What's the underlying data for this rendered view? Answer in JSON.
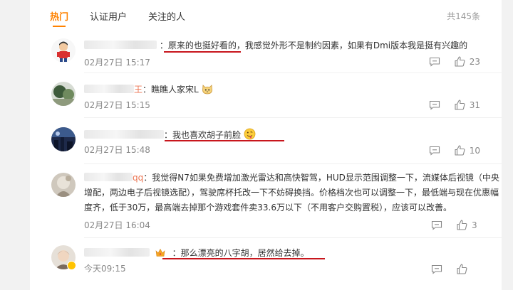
{
  "tabs": [
    {
      "label": "热门",
      "active": true
    },
    {
      "label": "认证用户",
      "active": false
    },
    {
      "label": "关注的人",
      "active": false
    }
  ],
  "total": "共145条",
  "accent_color": "#ff8200",
  "underline_color": "#c8161d",
  "comments": [
    {
      "text_highlight": "原来的也挺好看的",
      "text_rest": "，我感觉外形不是制约因素，如果有Dmi版本我是挺有兴趣的",
      "time": "02月27日 15:17",
      "likes": "23"
    },
    {
      "name_tail": "王",
      "text": "瞧瞧人家宋L",
      "emoji": "cat-face",
      "time": "02月27日 15:15",
      "likes": "31"
    },
    {
      "text_highlight": "我也喜欢胡子前脸",
      "emoji": "tongue-out-face",
      "time": "02月27日 15:48",
      "likes": "10"
    },
    {
      "name_tail": "qq",
      "text": "我觉得N7如果免费增加激光雷达和高快智驾，HUD显示范围调整一下，流媒体后视镜（中央增配，两边电子后视镜选配），驾驶席杯托改一下不妨碍换挡。价格档次也可以调整一下，最低端与现在优惠幅度齐，低于30万，最高端去掉那个游戏套件卖33.6万以下（不用客户交购置税），应该可以改善。",
      "time": "02月27日 16:04",
      "likes": "3"
    },
    {
      "text_highlight": "那么漂亮的八字胡，居然给去掉。",
      "time": "今天09:15",
      "likes": ""
    }
  ],
  "icons": {
    "reply": "comment-icon",
    "like": "thumbs-up-icon",
    "crown": "crown-icon",
    "verified": "verified-badge-icon"
  }
}
